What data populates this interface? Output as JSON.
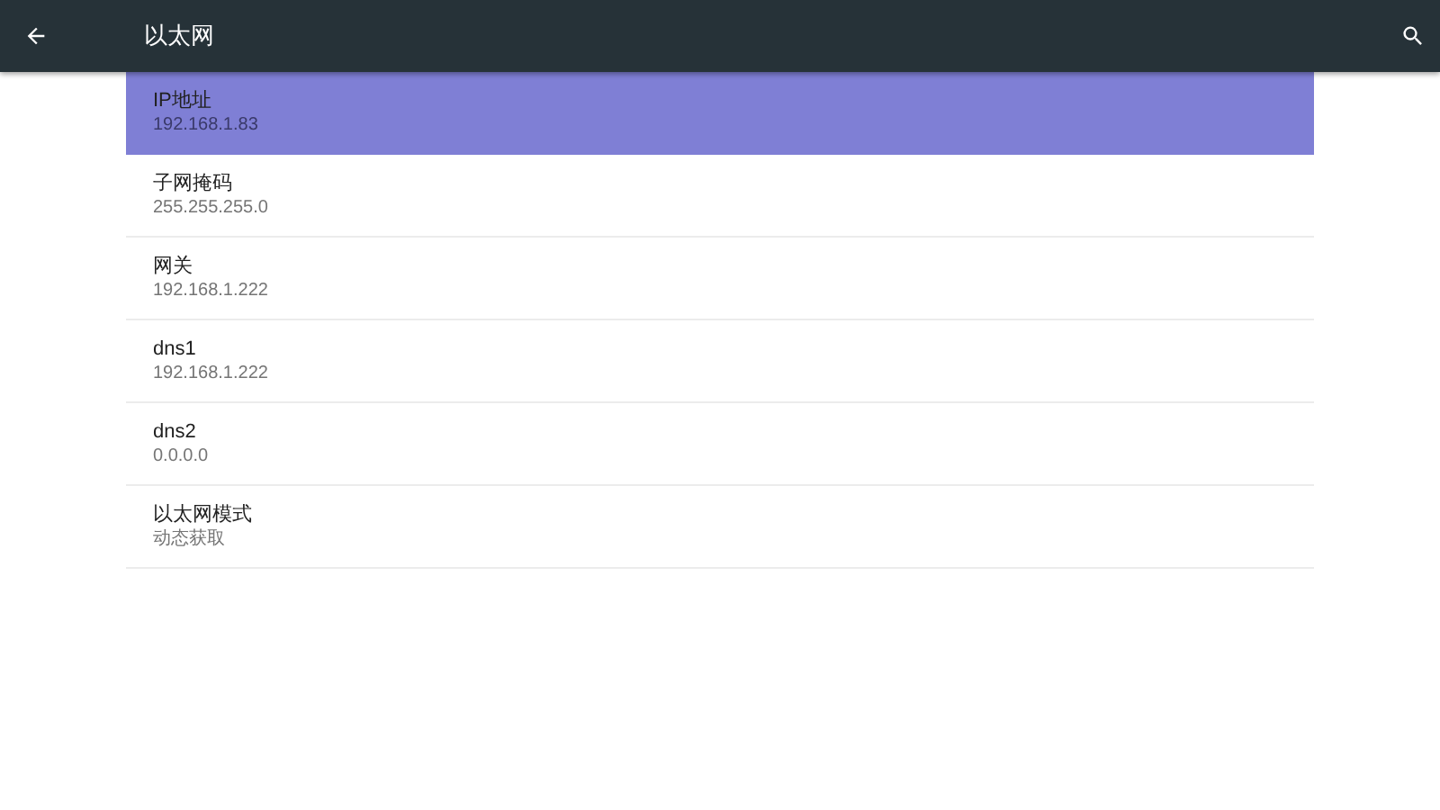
{
  "toolbar": {
    "title": "以太网"
  },
  "items": [
    {
      "title": "IP地址",
      "summary": "192.168.1.83",
      "selected": true
    },
    {
      "title": "子网掩码",
      "summary": "255.255.255.0",
      "selected": false
    },
    {
      "title": "网关",
      "summary": "192.168.1.222",
      "selected": false
    },
    {
      "title": "dns1",
      "summary": "192.168.1.222",
      "selected": false
    },
    {
      "title": "dns2",
      "summary": "0.0.0.0",
      "selected": false
    },
    {
      "title": "以太网模式",
      "summary": "动态获取",
      "selected": false
    }
  ]
}
